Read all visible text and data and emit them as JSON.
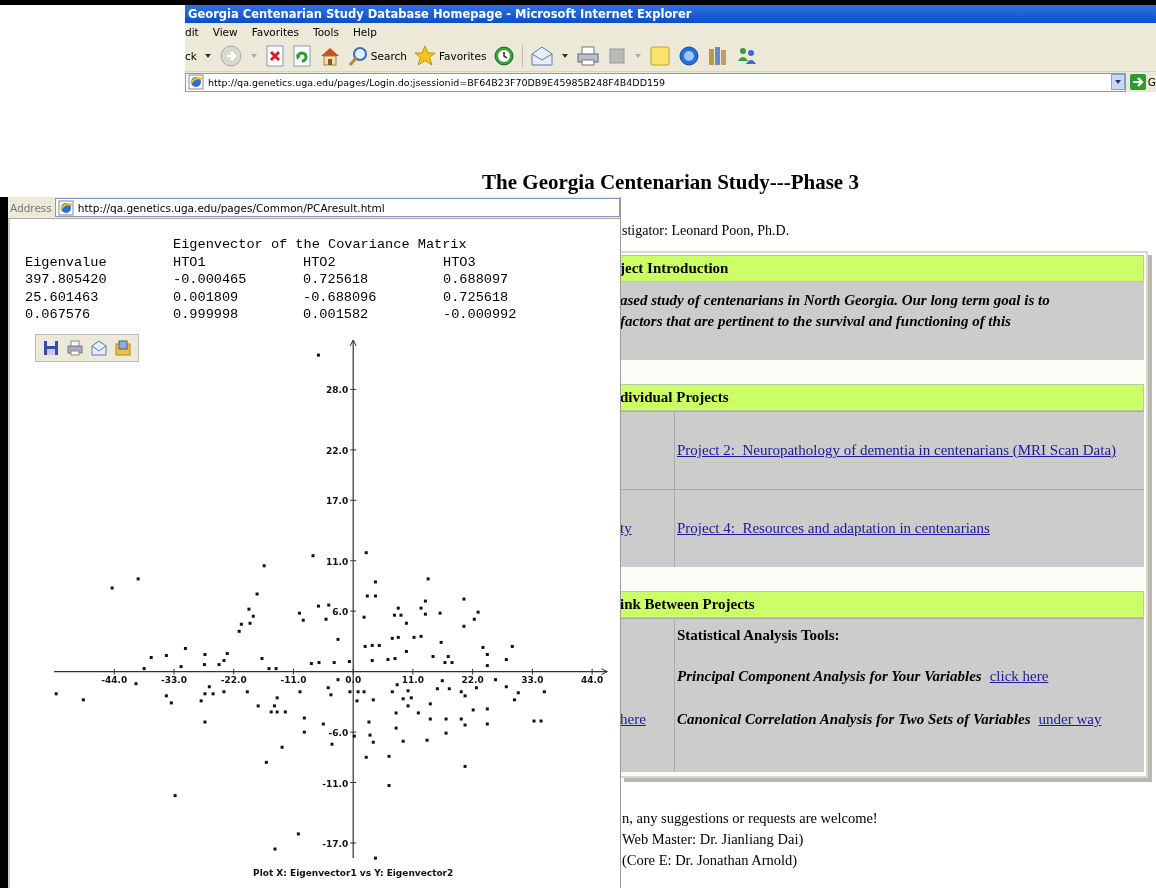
{
  "browser": {
    "title": "Georgia Centenarian Study Database Homepage - Microsoft Internet Explorer",
    "menu": [
      "dit",
      "View",
      "Favorites",
      "Tools",
      "Help"
    ],
    "toolbar": {
      "back_label": "ck",
      "search_label": "Search",
      "favorites_label": "Favorites"
    },
    "address": "http://qa.genetics.uga.edu/pages/Login.do;jsessionid=BF64B23F70DB9E45985B248F4B4DD159",
    "go_label": "G"
  },
  "page": {
    "title": "The Georgia Centenarian Study---Phase 3",
    "investigator": "stigator: Leonard Poon, Ph.D.",
    "sections": [
      {
        "kind": "text",
        "header": "ject Introduction",
        "lines": [
          "ased study of centenarians in North Georgia. Our long term goal is to",
          "factors that are pertinent to the survival and functioning of this"
        ]
      },
      {
        "kind": "projects",
        "header": "dividual Projects",
        "rows": [
          {
            "right": "Project 2:  Neuropathology of dementia in centenarians (MRI Scan Data)"
          },
          {
            "left": "ty",
            "right": "Project 4:  Resources and adaptation in centenarians"
          }
        ]
      },
      {
        "kind": "tools",
        "header": "ink Between Projects",
        "left": "here",
        "heading": "Statistical Analysis Tools:",
        "items": [
          {
            "text": "Principal Component Analysis for Your Variables",
            "link": "click here"
          },
          {
            "text": "Canonical Correlation Analysis for Two Sets of Variables",
            "link": "under way"
          }
        ]
      }
    ],
    "footer": [
      "n, any suggestions or requests are welcome!",
      "Web Master: Dr. Jianliang Dai)",
      "(Core E: Dr. Jonathan Arnold)"
    ]
  },
  "popup": {
    "address_label": "Address",
    "address": "http://qa.genetics.uga.edu/pages/Common/PCAresult.html",
    "matrix": {
      "title": "Eigenvector of the Covariance Matrix",
      "columns": [
        "Eigenvalue",
        "HTO1",
        "HTO2",
        "HTO3"
      ],
      "rows": [
        [
          "397.805420",
          "-0.000465",
          "0.725618",
          "0.688097"
        ],
        [
          "25.601463",
          "0.001809",
          "-0.688096",
          "0.725618"
        ],
        [
          "0.067576",
          "0.999998",
          "0.001582",
          "-0.000992"
        ]
      ]
    },
    "chart_data": {
      "type": "scatter",
      "title": "Plot  X: Eigenvector1 vs  Y: Eigenvector2",
      "x": [
        -6.4,
        -7.4,
        2.4,
        -16.4,
        -39.6,
        -44.4,
        4.1,
        13.8,
        2.6,
        4.1,
        -17.7,
        20.4,
        13.3,
        -19.2,
        -18.4,
        -19.0,
        -20.6,
        -21.0,
        -9.9,
        -9.2,
        -6.4,
        -4.5,
        -5.0,
        2.0,
        8.3,
        7.6,
        8.8,
        9.8,
        13.3,
        12.5,
        16.0,
        23.0,
        22.3,
        20.4,
        -2.8,
        7.2,
        8.3,
        11.2,
        12.5,
        16.2,
        23.9,
        24.7,
        29.3,
        28.2,
        2.2,
        3.5,
        4.8,
        9.8,
        -37.2,
        -34.4,
        -30.9,
        -27.3,
        -23.2,
        -23.8,
        -16.8,
        -7.7,
        -6.3,
        -3.5,
        -0.7,
        3.5,
        6.4,
        7.7,
        14.7,
        17.5,
        18.2,
        16.9,
        -38.5,
        -31.7,
        -27.4,
        -24.7,
        -15.5,
        -14.2,
        -40.0,
        -54.7,
        -49.7,
        -34.4,
        -33.5,
        -28.0,
        -27.3,
        -26.5,
        -25.8,
        -23.8,
        -19.5,
        -27.3,
        -17.5,
        -14.5,
        -14.0,
        -15.1,
        -14.0,
        -12.5,
        -9.8,
        -9.0,
        -9.0,
        -5.5,
        -4.6,
        -4.1,
        -3.9,
        -2.8,
        -0.6,
        0.9,
        2.0,
        0.7,
        0.2,
        2.9,
        3.1,
        3.7,
        3.7,
        2.4,
        -16.0,
        -13.1,
        6.6,
        6.6,
        7.2,
        8.1,
        7.9,
        7.9,
        9.2,
        9.2,
        10.1,
        10.7,
        10.1,
        12.0,
        13.6,
        14.2,
        14.2,
        15.5,
        16.4,
        17.7,
        17.1,
        17.1,
        19.9,
        20.6,
        19.9,
        20.6,
        20.6,
        22.1,
        22.7,
        24.7,
        24.7,
        24.7,
        26.2,
        28.2,
        29.7,
        30.4,
        33.3,
        34.6,
        35.2,
        -10.1,
        -14.4,
        4.1,
        -32.8
      ],
      "series": [
        {
          "values": [
            31.4,
            11.5,
            11.8,
            10.5,
            9.2,
            8.3,
            8.9,
            9.2,
            7.5,
            7.5,
            7.7,
            7.2,
            7.0,
            6.2,
            5.5,
            4.8,
            4.7,
            4.0,
            5.8,
            5.1,
            6.5,
            6.6,
            5.2,
            5.4,
            6.3,
            5.6,
            5.6,
            4.8,
            5.7,
            6.3,
            5.8,
            5.9,
            5.2,
            4.5,
            3.2,
            3.3,
            3.4,
            3.4,
            3.5,
            2.9,
            2.4,
            1.7,
            2.5,
            1.2,
            2.5,
            2.6,
            2.6,
            2.0,
            1.4,
            1.6,
            2.3,
            1.7,
            1.8,
            1.1,
            1.3,
            0.8,
            0.9,
            0.9,
            1.0,
            1.1,
            1.2,
            1.3,
            1.5,
            1.5,
            0.9,
            0.9,
            0.3,
            0.5,
            0.7,
            0.7,
            0.3,
            0.3,
            -1.2,
            -2.2,
            -2.8,
            -2.4,
            -3.1,
            -2.9,
            -2.2,
            -1.5,
            -2.2,
            -2.0,
            -2.0,
            -5.0,
            -3.4,
            -3.4,
            -2.6,
            -4.0,
            -4.0,
            -4.0,
            -2.0,
            -4.6,
            -6.0,
            -5.2,
            -1.6,
            -2.3,
            -7.2,
            -0.8,
            -2.0,
            -2.0,
            -2.0,
            -2.9,
            -6.4,
            -5.0,
            -6.3,
            -7.0,
            -2.8,
            -8.5,
            -9.0,
            -7.5,
            -8.4,
            -11.3,
            -2.0,
            -1.3,
            -4.1,
            -5.6,
            -6.9,
            -2.7,
            -1.9,
            -2.6,
            -3.4,
            -4.1,
            -6.8,
            -3.2,
            -4.7,
            -1.7,
            -0.9,
            -1.7,
            -4.7,
            -6.1,
            -2.0,
            -2.4,
            -4.7,
            -5.3,
            -9.4,
            -3.8,
            -1.6,
            0.6,
            -3.7,
            -5.2,
            -0.8,
            -1.5,
            -2.8,
            -2.1,
            -4.9,
            -4.9,
            -2.0,
            -16.1,
            -17.6,
            -18.5,
            -12.3
          ]
        }
      ],
      "xlim": [
        -55.1,
        46.8
      ],
      "ylim": [
        -18.5,
        32.9
      ],
      "xticks": [
        {
          "value": -44,
          "label": "-44.0"
        },
        {
          "value": -33,
          "label": "-33.0"
        },
        {
          "value": -22,
          "label": "-22.0"
        },
        {
          "value": -11,
          "label": "-11.0"
        },
        {
          "value": 0,
          "label": "0.0"
        },
        {
          "value": 11,
          "label": "11.0"
        },
        {
          "value": 22,
          "label": "22.0"
        },
        {
          "value": 33,
          "label": "33.0"
        },
        {
          "value": 44,
          "label": "44.0"
        }
      ],
      "yticks": [
        {
          "value": 28,
          "label": "28.0"
        },
        {
          "value": 22,
          "label": "22.0"
        },
        {
          "value": 17,
          "label": "17.0"
        },
        {
          "value": 11,
          "label": "11.0"
        },
        {
          "value": 6,
          "label": "6.0"
        },
        {
          "value": -6,
          "label": "-6.0"
        },
        {
          "value": -11,
          "label": "-11.0"
        },
        {
          "value": -17,
          "label": "-17.0"
        }
      ]
    }
  }
}
